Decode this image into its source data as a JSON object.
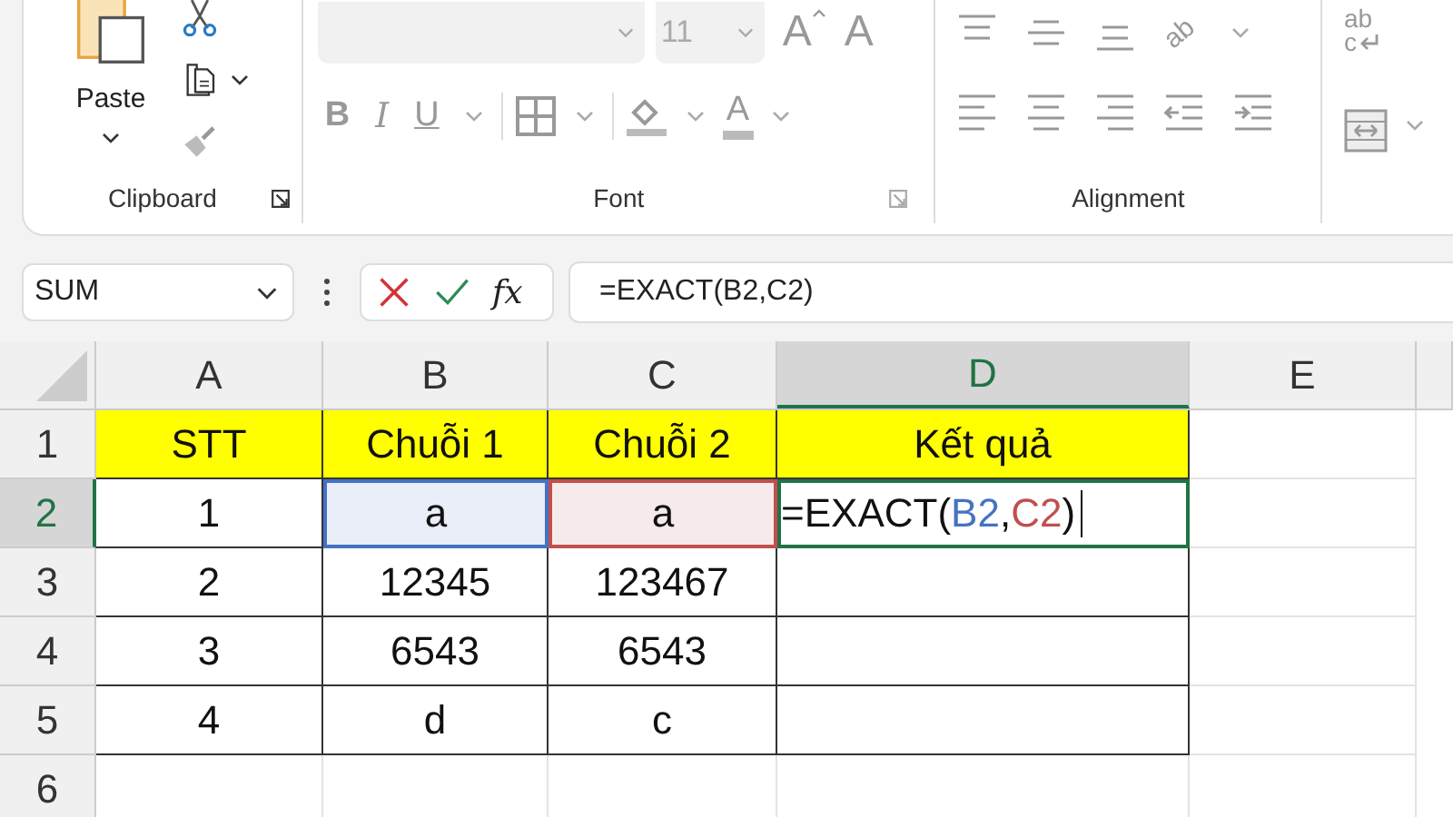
{
  "ribbon": {
    "clipboard": {
      "label": "Clipboard",
      "paste": "Paste"
    },
    "font": {
      "label": "Font",
      "size": "11",
      "bold": "B",
      "italic": "I",
      "underline": "U",
      "grow": "A",
      "shrink": "A",
      "font_color": "A"
    },
    "alignment": {
      "label": "Alignment",
      "orientation": "ab"
    },
    "wrap": {
      "top": "ab",
      "bottom": "c"
    }
  },
  "formula_bar": {
    "name_box": "SUM",
    "function_label": "fx",
    "formula": "=EXACT(B2,C2)"
  },
  "grid": {
    "columns": [
      {
        "label": "A",
        "selected": false
      },
      {
        "label": "B",
        "selected": false
      },
      {
        "label": "C",
        "selected": false
      },
      {
        "label": "D",
        "selected": true
      },
      {
        "label": "E",
        "selected": false
      }
    ],
    "rows": [
      {
        "label": "1",
        "selected": false,
        "cells": [
          {
            "kind": "header",
            "text": "STT"
          },
          {
            "kind": "header",
            "text": "Chuỗi 1"
          },
          {
            "kind": "header",
            "text": "Chuỗi 2"
          },
          {
            "kind": "header",
            "text": "Kết quả"
          }
        ]
      },
      {
        "label": "2",
        "selected": true,
        "cells": [
          {
            "kind": "value",
            "text": "1"
          },
          {
            "kind": "reference",
            "text": "a",
            "color": "#4472c4"
          },
          {
            "kind": "reference",
            "text": "a",
            "color": "#c0504d"
          },
          {
            "kind": "editing",
            "parts": [
              {
                "text": "=EXACT("
              },
              {
                "text": "B2",
                "color": "#4472c4"
              },
              {
                "text": ","
              },
              {
                "text": "C2",
                "color": "#c0504d"
              },
              {
                "text": ")"
              }
            ]
          }
        ]
      },
      {
        "label": "3",
        "selected": false,
        "cells": [
          {
            "kind": "value",
            "text": "2"
          },
          {
            "kind": "value",
            "text": "12345"
          },
          {
            "kind": "value",
            "text": "123467"
          },
          {
            "kind": "value"
          }
        ]
      },
      {
        "label": "4",
        "selected": false,
        "cells": [
          {
            "kind": "value",
            "text": "3"
          },
          {
            "kind": "value",
            "text": "6543"
          },
          {
            "kind": "value",
            "text": "6543"
          },
          {
            "kind": "value"
          }
        ]
      },
      {
        "label": "5",
        "selected": false,
        "cells": [
          {
            "kind": "value",
            "text": "4"
          },
          {
            "kind": "value",
            "text": "d"
          },
          {
            "kind": "value",
            "text": "c"
          },
          {
            "kind": "value"
          }
        ]
      },
      {
        "label": "6",
        "selected": false,
        "cells": []
      }
    ]
  }
}
